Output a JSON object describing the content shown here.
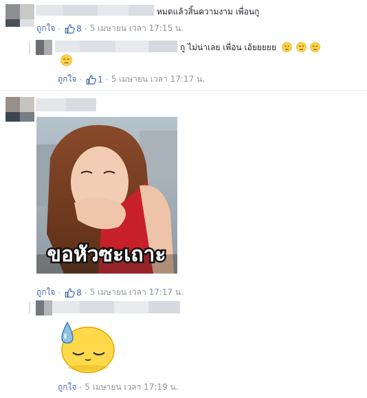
{
  "comments": [
    {
      "text": "หมดแล้วสิ้นความงาม เพื่อนกู",
      "like_label": "ถูกใจ",
      "like_count": "8",
      "timestamp": "5 เมษายน เวลา 17:15 น."
    },
    {
      "text": "กู ไม่น่าเลย เพื่อน เอ้ยยยยย",
      "like_label": "ถูกใจ",
      "like_count": "1",
      "timestamp": "5 เมษายน เวลา 17:17 น."
    },
    {
      "image_caption": "ขอหัวซะเถาะ",
      "like_label": "ถูกใจ",
      "like_count": "8",
      "timestamp": "5 เมษายน เวลา 17:17 น."
    },
    {
      "sticker": "sweat-drop-face-sticker",
      "like_label": "ถูกใจ",
      "timestamp": "5 เมษายน เวลา 17:19 น."
    }
  ],
  "colors": {
    "link": "#4267b2",
    "meta": "#90949c",
    "text": "#1d2129",
    "photo_dress": "#c8202a",
    "sticker_face": "#ffd94a"
  }
}
